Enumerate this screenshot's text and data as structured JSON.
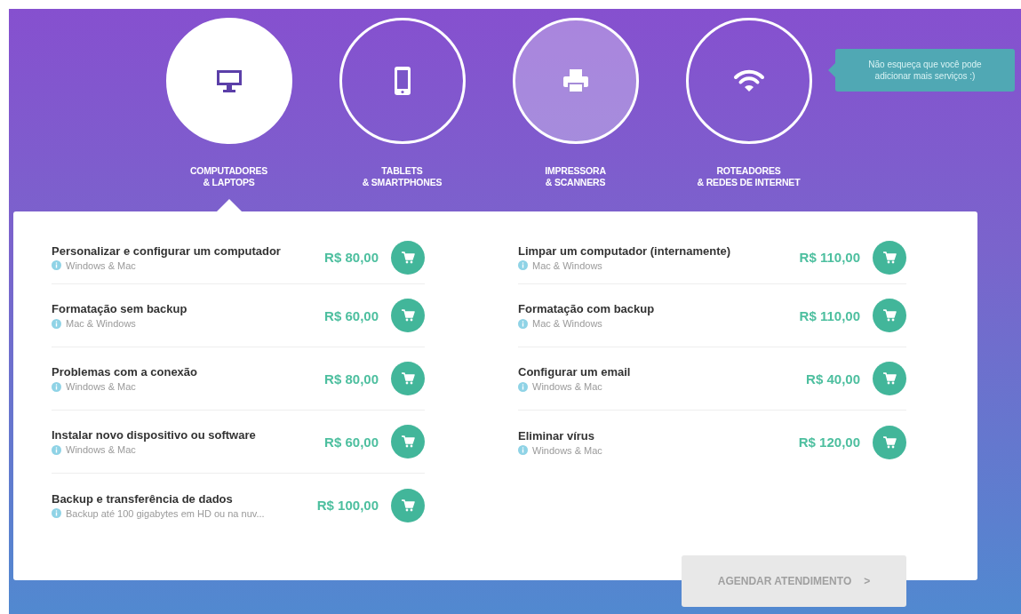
{
  "categories": [
    {
      "label_line_1": "COMPUTADORES",
      "label_line_2": "& LAPTOPS",
      "selected": true,
      "highlighted": false
    },
    {
      "label_line_1": "TABLETS",
      "label_line_2": "& SMARTPHONES",
      "selected": false,
      "highlighted": false
    },
    {
      "label_line_1": "IMPRESSORA",
      "label_line_2": "& SCANNERS",
      "selected": false,
      "highlighted": true
    },
    {
      "label_line_1": "ROTEADORES",
      "label_line_2": "& REDES DE INTERNET",
      "selected": false,
      "highlighted": false
    }
  ],
  "tooltip": "Não esqueça que você pode adicionar mais serviços :)",
  "services_left": [
    {
      "name": "Personalizar e configurar um computador",
      "platforms": "Windows & Mac",
      "price": "R$ 80,00"
    },
    {
      "name": "Formatação sem backup",
      "platforms": "Mac & Windows",
      "price": "R$ 60,00"
    },
    {
      "name": "Problemas com a conexão",
      "platforms": "Windows & Mac",
      "price": "R$ 80,00"
    },
    {
      "name": "Instalar novo dispositivo ou software",
      "platforms": "Windows & Mac",
      "price": "R$ 60,00"
    },
    {
      "name": "Backup e transferência de dados",
      "platforms": "Backup até 100 gigabytes em HD ou na nuv...",
      "price": "R$ 100,00"
    }
  ],
  "services_right": [
    {
      "name": "Limpar um computador (internamente)",
      "platforms": "Mac & Windows",
      "price": "R$ 110,00"
    },
    {
      "name": "Formatação com backup",
      "platforms": "Mac & Windows",
      "price": "R$ 110,00"
    },
    {
      "name": "Configurar um email",
      "platforms": "Windows & Mac",
      "price": "R$ 40,00"
    },
    {
      "name": "Eliminar vírus",
      "platforms": "Windows & Mac",
      "price": "R$ 120,00"
    }
  ],
  "schedule_button": {
    "label": "AGENDAR ATENDIMENTO",
    "arrow": ">",
    "disabled": true
  }
}
